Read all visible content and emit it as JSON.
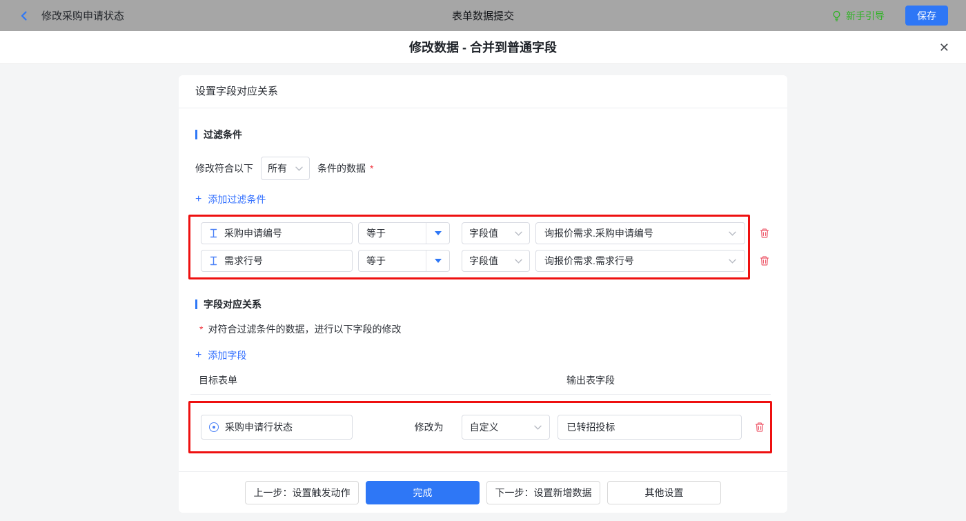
{
  "colors": {
    "accent": "#2e77f6",
    "link": "#3370ff",
    "annotation": "#ee1010",
    "delete": "#ee5d6e",
    "guide-green": "#2fb324",
    "required": "#f0333c"
  },
  "topbar": {
    "title": "修改采购申请状态",
    "center_title": "表单数据提交",
    "guide_label": "新手引导",
    "save_label": "保存"
  },
  "dialog": {
    "title": "修改数据 - 合并到普通字段",
    "close_glyph": "✕"
  },
  "panel": {
    "header": "设置字段对应关系",
    "filter": {
      "title": "过滤条件",
      "match_prefix": "修改符合以下",
      "match_value": "所有",
      "match_suffix": "条件的数据",
      "required_mark": "*",
      "add_icon": "+",
      "add_label": "添加过滤条件",
      "rows": [
        {
          "field": "采购申请编号",
          "operator": "等于",
          "value_type": "字段值",
          "value": "询报价需求.采购申请编号"
        },
        {
          "field": "需求行号",
          "operator": "等于",
          "value_type": "字段值",
          "value": "询报价需求.需求行号"
        }
      ]
    },
    "mapping": {
      "title": "字段对应关系",
      "required_mark": "*",
      "description": "对符合过滤条件的数据，进行以下字段的修改",
      "add_icon": "+",
      "add_label": "添加字段",
      "col_target": "目标表单",
      "col_output": "输出表字段",
      "rows": [
        {
          "field": "采购申请行状态",
          "action_label": "修改为",
          "mode": "自定义",
          "value": "已转招投标"
        }
      ]
    },
    "footer": {
      "prev_label": "上一步：设置触发动作",
      "done_label": "完成",
      "next_label": "下一步：设置新增数据",
      "other_label": "其他设置"
    }
  }
}
